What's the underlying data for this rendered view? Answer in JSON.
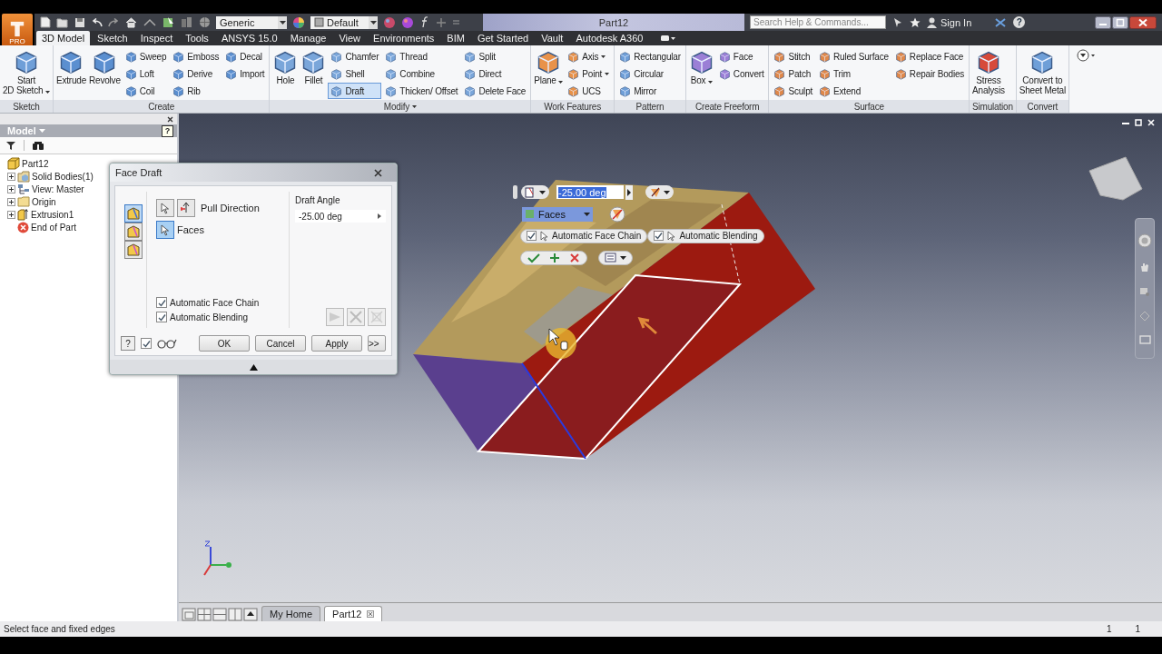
{
  "title_bar": {
    "badge": "PRO",
    "material": "Generic",
    "appearance": "Default",
    "title": "Part12",
    "search": {
      "placeholder": "Search Help & Commands..."
    },
    "sign_in": "Sign In",
    "help": "?"
  },
  "tabs": [
    {
      "label": "3D Model",
      "selected": true
    },
    {
      "label": "Sketch",
      "selected": false
    },
    {
      "label": "Inspect",
      "selected": false
    },
    {
      "label": "Tools",
      "selected": false
    },
    {
      "label": "ANSYS 15.0",
      "selected": false
    },
    {
      "label": "Manage",
      "selected": false
    },
    {
      "label": "View",
      "selected": false
    },
    {
      "label": "Environments",
      "selected": false
    },
    {
      "label": "BIM",
      "selected": false
    },
    {
      "label": "Get Started",
      "selected": false
    },
    {
      "label": "Vault",
      "selected": false
    },
    {
      "label": "Autodesk A360",
      "selected": false
    }
  ],
  "ribbon": [
    {
      "label": "Sketch",
      "menu": false,
      "groups": [
        {
          "kind": "big",
          "tools": [
            {
              "label": "Start\n2D Sketch",
              "selected": false,
              "menu": true
            }
          ]
        }
      ]
    },
    {
      "label": "Create",
      "menu": false,
      "groups": [
        {
          "kind": "big",
          "tools": [
            {
              "label": "Extrude",
              "selected": false,
              "menu": false
            },
            {
              "label": "Revolve",
              "selected": false,
              "menu": false
            }
          ]
        },
        {
          "kind": "small",
          "tools": [
            {
              "label": "Sweep",
              "selected": false,
              "menu": false
            },
            {
              "label": "Loft",
              "selected": false,
              "menu": false
            },
            {
              "label": "Coil",
              "selected": false,
              "menu": false
            }
          ]
        },
        {
          "kind": "small",
          "tools": [
            {
              "label": "Emboss",
              "selected": false,
              "menu": false
            },
            {
              "label": "Derive",
              "selected": false,
              "menu": false
            },
            {
              "label": "Rib",
              "selected": false,
              "menu": false
            }
          ]
        },
        {
          "kind": "small",
          "tools": [
            {
              "label": "Decal",
              "selected": false,
              "menu": false
            },
            {
              "label": "Import",
              "selected": false,
              "menu": false
            }
          ]
        }
      ]
    },
    {
      "label": "Modify",
      "menu": true,
      "groups": [
        {
          "kind": "big",
          "tools": [
            {
              "label": "Hole",
              "selected": false,
              "menu": false
            },
            {
              "label": "Fillet",
              "selected": false,
              "menu": false
            }
          ]
        },
        {
          "kind": "small",
          "tools": [
            {
              "label": "Chamfer",
              "selected": false,
              "menu": false
            },
            {
              "label": "Shell",
              "selected": false,
              "menu": false
            },
            {
              "label": "Draft",
              "selected": true,
              "menu": false
            }
          ]
        },
        {
          "kind": "small",
          "tools": [
            {
              "label": "Thread",
              "selected": false,
              "menu": false
            },
            {
              "label": "Combine",
              "selected": false,
              "menu": false
            },
            {
              "label": "Thicken/ Offset",
              "selected": false,
              "menu": false
            }
          ]
        },
        {
          "kind": "small",
          "tools": [
            {
              "label": "Split",
              "selected": false,
              "menu": false
            },
            {
              "label": "Direct",
              "selected": false,
              "menu": false
            },
            {
              "label": "Delete Face",
              "selected": false,
              "menu": false
            }
          ]
        }
      ]
    },
    {
      "label": "Work Features",
      "menu": false,
      "groups": [
        {
          "kind": "big",
          "tools": [
            {
              "label": "Plane",
              "selected": false,
              "menu": true
            }
          ]
        },
        {
          "kind": "small",
          "tools": [
            {
              "label": "Axis",
              "selected": false,
              "menu": true
            },
            {
              "label": "Point",
              "selected": false,
              "menu": true
            },
            {
              "label": "UCS",
              "selected": false,
              "menu": false
            }
          ]
        }
      ]
    },
    {
      "label": "Pattern",
      "menu": false,
      "groups": [
        {
          "kind": "small",
          "tools": [
            {
              "label": "Rectangular",
              "selected": false,
              "menu": false
            },
            {
              "label": "Circular",
              "selected": false,
              "menu": false
            },
            {
              "label": "Mirror",
              "selected": false,
              "menu": false
            }
          ]
        }
      ]
    },
    {
      "label": "Create Freeform",
      "menu": false,
      "groups": [
        {
          "kind": "big",
          "tools": [
            {
              "label": "Box",
              "selected": false,
              "menu": true
            }
          ]
        },
        {
          "kind": "small",
          "tools": [
            {
              "label": "Face",
              "selected": false,
              "menu": false
            },
            {
              "label": "Convert",
              "selected": false,
              "menu": false
            }
          ]
        }
      ]
    },
    {
      "label": "Surface",
      "menu": false,
      "groups": [
        {
          "kind": "small",
          "tools": [
            {
              "label": "Stitch",
              "selected": false,
              "menu": false
            },
            {
              "label": "Patch",
              "selected": false,
              "menu": false
            },
            {
              "label": "Sculpt",
              "selected": false,
              "menu": false
            }
          ]
        },
        {
          "kind": "small",
          "tools": [
            {
              "label": "Ruled Surface",
              "selected": false,
              "menu": false
            },
            {
              "label": "Trim",
              "selected": false,
              "menu": false
            },
            {
              "label": "Extend",
              "selected": false,
              "menu": false
            }
          ]
        },
        {
          "kind": "small",
          "tools": [
            {
              "label": "Replace Face",
              "selected": false,
              "menu": false
            },
            {
              "label": "Repair Bodies",
              "selected": false,
              "menu": false
            }
          ]
        }
      ]
    },
    {
      "label": "Simulation",
      "menu": false,
      "groups": [
        {
          "kind": "big",
          "tools": [
            {
              "label": "Stress\nAnalysis",
              "selected": false,
              "menu": false
            }
          ]
        }
      ]
    },
    {
      "label": "Convert",
      "menu": false,
      "groups": [
        {
          "kind": "big",
          "tools": [
            {
              "label": "Convert to\nSheet Metal",
              "selected": false,
              "menu": false
            }
          ]
        }
      ]
    }
  ],
  "browser": {
    "title": "Model",
    "help": "?",
    "tree": [
      {
        "label": "Part12",
        "kind": "part",
        "expandable": false,
        "children": [
          {
            "label": "Solid Bodies(1)",
            "kind": "bodies",
            "expandable": true
          },
          {
            "label": "View: Master",
            "kind": "view",
            "expandable": true
          },
          {
            "label": "Origin",
            "kind": "folder",
            "expandable": true
          },
          {
            "label": "Extrusion1",
            "kind": "feature",
            "expandable": true
          },
          {
            "label": "End of Part",
            "kind": "end",
            "expandable": false
          }
        ]
      }
    ]
  },
  "dialog": {
    "title": "Face Draft",
    "types": [
      {
        "selected": true
      },
      {
        "selected": false
      },
      {
        "selected": false
      }
    ],
    "selectors": [
      {
        "label": "Pull Direction",
        "selected": false
      },
      {
        "label": "Faces",
        "selected": true
      }
    ],
    "options": [
      {
        "label": "Automatic Face Chain",
        "checked": true
      },
      {
        "label": "Automatic Blending",
        "checked": true
      }
    ],
    "draft_angle": {
      "label": "Draft Angle",
      "value": "-25.00 deg"
    },
    "help": "?",
    "preview": {
      "checked": true
    },
    "buttons": [
      "OK",
      "Cancel",
      "Apply",
      ">>"
    ]
  },
  "mini_toolbar": {
    "angle": "-25.00 deg",
    "selection": "Faces",
    "options": [
      {
        "label": "Automatic Face Chain",
        "checked": true
      },
      {
        "label": "Automatic Blending",
        "checked": true
      }
    ]
  },
  "document_tabs": [
    {
      "label": "My Home",
      "selected": false
    },
    {
      "label": "Part12",
      "selected": true
    }
  ],
  "status_bar": {
    "message": "Select face and fixed edges",
    "values": [
      "1",
      "1"
    ]
  }
}
